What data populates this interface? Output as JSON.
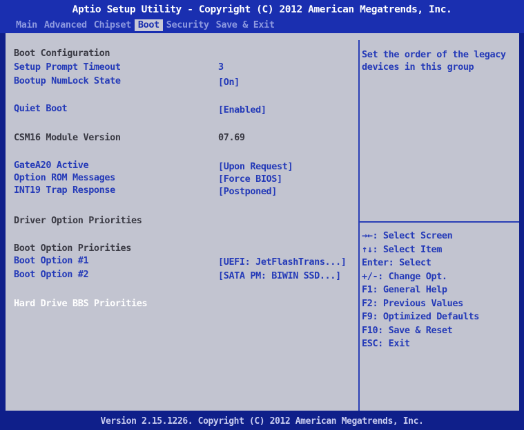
{
  "header": {
    "title": "Aptio Setup Utility - Copyright (C) 2012 American Megatrends, Inc.",
    "tabs": [
      "Main",
      "Advanced",
      "Chipset",
      "Boot",
      "Security",
      "Save & Exit"
    ],
    "active_tab": "Boot"
  },
  "settings": {
    "boot_configuration": "Boot Configuration",
    "setup_prompt_timeout": {
      "label": "Setup Prompt Timeout",
      "value": "3"
    },
    "bootup_numlock_state": {
      "label": "Bootup NumLock State",
      "value": "[On]"
    },
    "quiet_boot": {
      "label": "Quiet Boot",
      "value": "[Enabled]"
    },
    "csm16_module_version": {
      "label": "CSM16 Module Version",
      "value": "07.69"
    },
    "gatea20_active": {
      "label": "GateA20 Active",
      "value": "[Upon Request]"
    },
    "option_rom_messages": {
      "label": "Option ROM Messages",
      "value": "[Force BIOS]"
    },
    "int19_trap_response": {
      "label": "INT19 Trap Response",
      "value": "[Postponed]"
    },
    "driver_option_priorities": "Driver Option Priorities",
    "boot_option_priorities": "Boot Option Priorities",
    "boot_option_1": {
      "label": "Boot Option #1",
      "value": "[UEFI: JetFlashTrans...]"
    },
    "boot_option_2": {
      "label": "Boot Option #2",
      "value": "[SATA  PM: BIWIN SSD...]"
    },
    "hard_drive_bbs_priorities": "Hard Drive BBS Priorities"
  },
  "help": {
    "text": "Set the order of the legacy\ndevices in this group"
  },
  "keys": [
    "→←: Select Screen",
    "↑↓: Select Item",
    "Enter: Select",
    "+/-: Change Opt.",
    "F1: General Help",
    "F2: Previous Values",
    "F9: Optimized Defaults",
    "F10: Save & Reset",
    "ESC: Exit"
  ],
  "footer": {
    "version": "Version 2.15.1226. Copyright (C) 2012 American Megatrends, Inc."
  },
  "colors": {
    "background": "#0f1f8a",
    "panel": "#c2c4d0",
    "highlight_text": "#243ab8",
    "static_text": "#3a3a44"
  }
}
